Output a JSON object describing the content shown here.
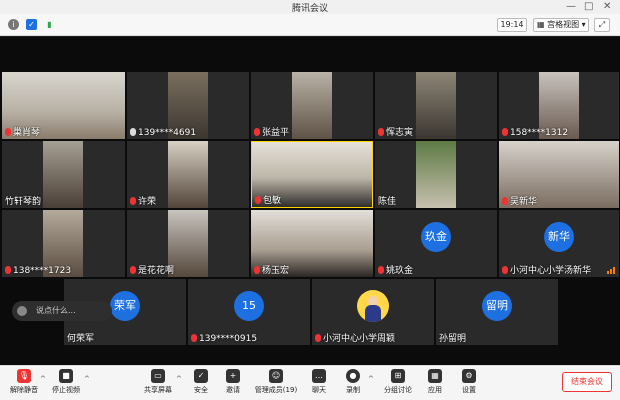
{
  "window": {
    "title": "腾讯会议"
  },
  "topbar": {
    "time": "19:14",
    "view_label": "宫格视图"
  },
  "participants": [
    {
      "name": "巢肖琴",
      "type": "video"
    },
    {
      "name": "139****4691",
      "type": "video"
    },
    {
      "name": "张益平",
      "type": "video"
    },
    {
      "name": "恽志寅",
      "type": "video"
    },
    {
      "name": "158****1312",
      "type": "video"
    },
    {
      "name": "竹轩琴韵",
      "type": "video"
    },
    {
      "name": "许荣",
      "type": "video"
    },
    {
      "name": "包敏",
      "type": "video"
    },
    {
      "name": "陈佳",
      "type": "video"
    },
    {
      "name": "吴新华",
      "type": "video"
    },
    {
      "name": "138****1723",
      "type": "video"
    },
    {
      "name": "是花花啊",
      "type": "video"
    },
    {
      "name": "杨玉宏",
      "type": "video"
    },
    {
      "name": "姚玖金",
      "type": "avatar",
      "avatar_text": "玖金"
    },
    {
      "name": "小河中心小学汤新华",
      "type": "avatar",
      "avatar_text": "新华"
    },
    {
      "name": "何荣军",
      "type": "avatar",
      "avatar_text": "荣军"
    },
    {
      "name": "139****0915",
      "type": "avatar",
      "avatar_text": "15"
    },
    {
      "name": "小河中心小学周颖",
      "type": "photo-avatar"
    },
    {
      "name": "孙留明",
      "type": "avatar",
      "avatar_text": "留明"
    }
  ],
  "chat": {
    "placeholder": "说点什么..."
  },
  "toolbar": {
    "mute": "解除静音",
    "video": "停止视频",
    "share": "共享屏幕",
    "security": "安全",
    "invite": "邀请",
    "members": "管理成员(19)",
    "chat": "聊天",
    "record": "录制",
    "breakout": "分组讨论",
    "apps": "应用",
    "settings": "设置",
    "end": "结束会议"
  },
  "colors": {
    "accent": "#1e6fe0",
    "danger": "#e33333",
    "stage": "#0b0b0b"
  }
}
